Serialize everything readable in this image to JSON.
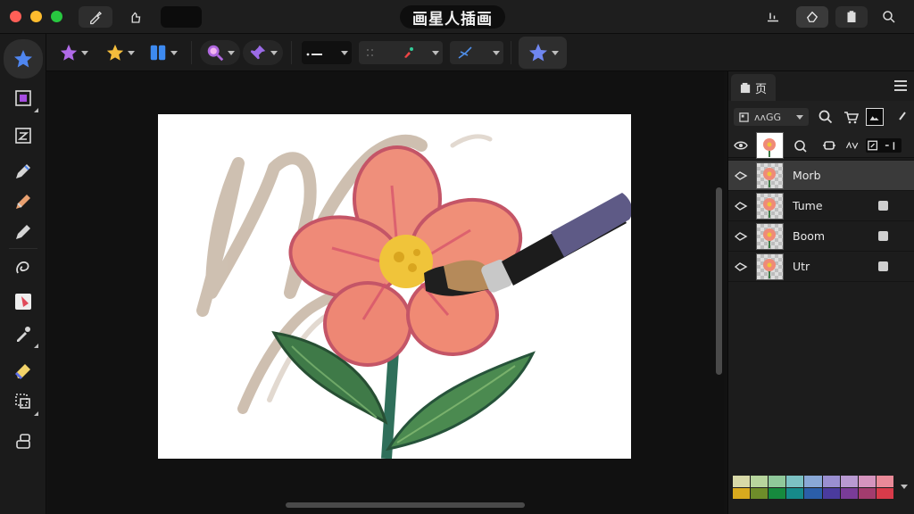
{
  "window": {
    "title": "画星人插画"
  },
  "layers_panel": {
    "tab_label": "页",
    "blend_mode": "ʌʌGG",
    "layers": [
      {
        "name": "Morb",
        "selected": true
      },
      {
        "name": "Tume",
        "selected": false
      },
      {
        "name": "Boom",
        "selected": false
      },
      {
        "name": "Utr",
        "selected": false
      }
    ],
    "palette": [
      "#d8d9a8",
      "#b7d59d",
      "#8fc89a",
      "#7cc1c3",
      "#89a8d6",
      "#9a8fd1",
      "#b99ad2",
      "#d594be",
      "#e98a98",
      "#d9aa1e",
      "#6e8d2a",
      "#168a3e",
      "#168a8a",
      "#2b5ea8",
      "#4a3b9e",
      "#7a3c98",
      "#a33c6e",
      "#d83b4a"
    ]
  },
  "colors": {
    "accent_blue": "#4f7df0",
    "accent_purple": "#a65be0",
    "accent_yellow": "#f3b63a",
    "canvas": "#ffffff"
  },
  "icons": {
    "titlebar": [
      "brush-tool-icon",
      "gesture-icon",
      "export-icon",
      "selection-icon",
      "clipboard-icon",
      "search-icon"
    ],
    "toolbar": [
      "star-brush-icon",
      "star-icon",
      "split-view-icon",
      "magnify-icon",
      "pin-icon",
      "brush-size-icon",
      "opacity-icon",
      "color-picker-icon",
      "stroke-icon",
      "star-favorite-icon"
    ],
    "tools": [
      "star-tool-icon",
      "transform-icon",
      "adjust-icon",
      "pen-icon",
      "marker-icon",
      "pencil-icon",
      "lasso-icon",
      "fill-icon",
      "eyedropper-icon",
      "eraser-icon",
      "layer-icon",
      "undo-icon"
    ]
  }
}
